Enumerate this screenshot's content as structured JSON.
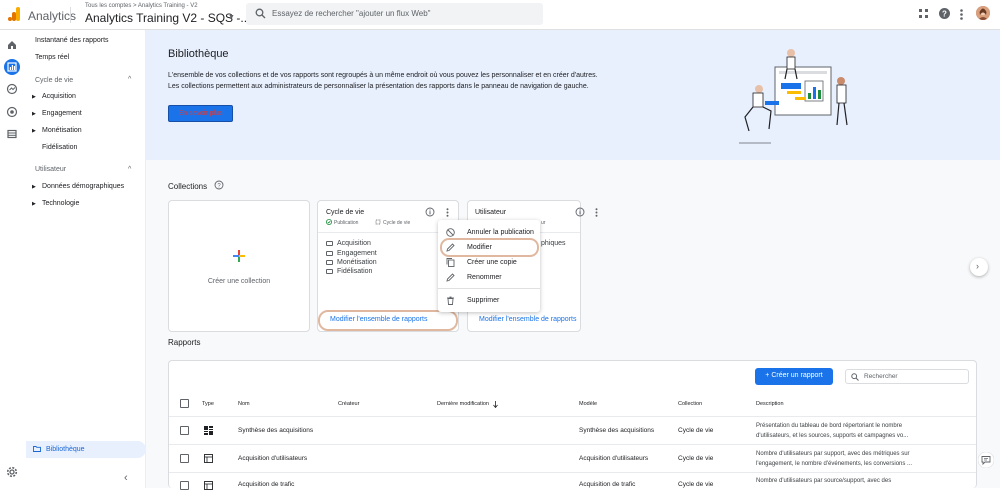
{
  "topbar": {
    "app_name": "Analytics",
    "breadcrumb": "Tous les comptes > Analytics Training - V2",
    "property_name": "Analytics Training V2 - SQS -...",
    "search_placeholder": "Essayez de rechercher \"ajouter un flux Web\""
  },
  "sidebar": {
    "snapshot": "Instantané des rapports",
    "realtime": "Temps réel",
    "lifecycle_section": "Cycle de vie",
    "lifecycle_items": [
      "Acquisition",
      "Engagement",
      "Monétisation",
      "Fidélisation"
    ],
    "user_section": "Utilisateur",
    "user_items": [
      "Données démographiques",
      "Technologie"
    ],
    "library": "Bibliothèque"
  },
  "banner": {
    "title": "Bibliothèque",
    "line1": "L'ensemble de vos collections et de vos rapports sont regroupés à un même endroit où vous pouvez les personnaliser et en créer d'autres.",
    "line2": "Les collections permettent aux administrateurs de personnaliser la présentation des rapports dans le panneau de navigation de gauche.",
    "button": "En savoir plus"
  },
  "collections": {
    "title": "Collections",
    "create_label": "Créer une collection",
    "cycle": {
      "title": "Cycle de vie",
      "status": "Publication",
      "template": "Cycle de vie",
      "items": [
        "Acquisition",
        "Engagement",
        "Monétisation",
        "Fidélisation"
      ],
      "edit_link": "Modifier l'ensemble de rapports"
    },
    "user": {
      "title": "Utilisateur",
      "partial_meta": "ur",
      "partial_item": "phiques",
      "edit_link": "Modifier l'ensemble de rapports"
    }
  },
  "menu": {
    "items": [
      "Annuler la publication",
      "Modifier",
      "Créer une copie",
      "Renommer",
      "Supprimer"
    ]
  },
  "reports": {
    "title": "Rapports",
    "create_button": "Créer un rapport",
    "search_placeholder": "Rechercher",
    "columns": [
      "Type",
      "Nom",
      "Créateur",
      "Dernière modification",
      "Modèle",
      "Collection",
      "Description"
    ],
    "rows": [
      {
        "name": "Synthèse des acquisitions",
        "model": "Synthèse des acquisitions",
        "collection": "Cycle de vie",
        "desc1": "Présentation du tableau de bord répertoriant le nombre",
        "desc2": "d'utilisateurs, et les sources, supports et campagnes vo..."
      },
      {
        "name": "Acquisition d'utilisateurs",
        "model": "Acquisition d'utilisateurs",
        "collection": "Cycle de vie",
        "desc1": "Nombre d'utilisateurs par support, avec des métriques sur",
        "desc2": "l'engagement, le nombre d'événements, les conversions ..."
      },
      {
        "name": "Acquisition de trafic",
        "model": "Acquisition de trafic",
        "collection": "Cycle de vie",
        "desc1": "Nombre d'utilisateurs par source/support, avec des",
        "desc2": ""
      }
    ]
  }
}
